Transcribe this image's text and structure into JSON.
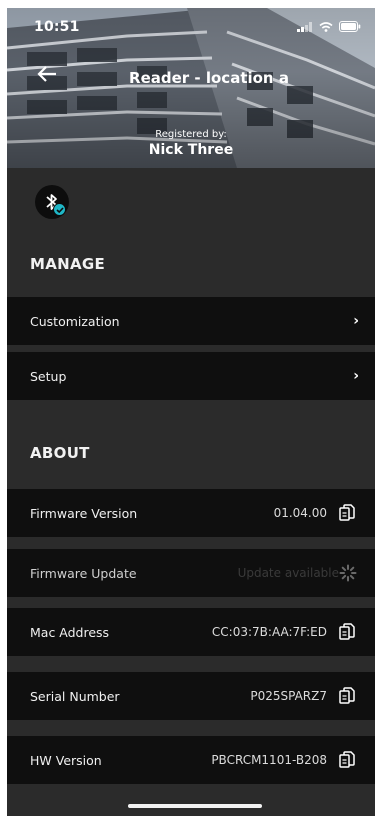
{
  "status_bar": {
    "time": "10:51"
  },
  "header": {
    "title": "Reader - location a",
    "registered_label": "Registered by:",
    "registered_name": "Nick Three"
  },
  "manage": {
    "heading": "MANAGE",
    "items": [
      {
        "label": "Customization"
      },
      {
        "label": "Setup"
      }
    ]
  },
  "about": {
    "heading": "ABOUT",
    "items": [
      {
        "label": "Firmware Version",
        "value": "01.04.00"
      },
      {
        "label": "Firmware Update",
        "value": "Update available"
      },
      {
        "label": "Mac Address",
        "value": "CC:03:7B:AA:7F:ED"
      },
      {
        "label": "Serial Number",
        "value": "P025SPARZ7"
      },
      {
        "label": "HW Version",
        "value": "PBCRCM1101-B208"
      }
    ]
  },
  "colors": {
    "background": "#2b2b2b",
    "row": "#0f0f0f",
    "accent": "#1fb7c7"
  },
  "icons": {
    "back": "back-arrow-icon",
    "bluetooth": "bluetooth-icon",
    "chevron": "chevron-right-icon",
    "copy": "copy-icon",
    "loading": "spinner-icon"
  }
}
